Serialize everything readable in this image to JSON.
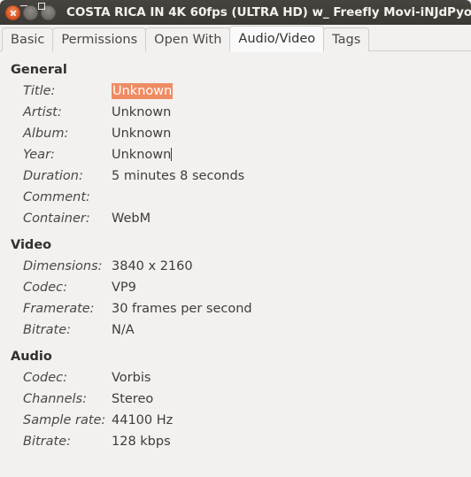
{
  "window": {
    "title": "COSTA RICA IN 4K 60fps (ULTRA HD) w_ Freefly Movi-iNJdPyo",
    "controls": {
      "close": "close-button",
      "minimize": "minimize-button",
      "maximize": "maximize-button"
    },
    "titlebar_color": "#413e3a",
    "background_color": "#f2f1f0",
    "selection_color": "#ef8b63"
  },
  "tabs": [
    {
      "label": "Basic",
      "active": false
    },
    {
      "label": "Permissions",
      "active": false
    },
    {
      "label": "Open With",
      "active": false
    },
    {
      "label": "Audio/Video",
      "active": true
    },
    {
      "label": "Tags",
      "active": false
    }
  ],
  "sections": [
    {
      "title": "General",
      "rows": [
        {
          "label": "Title:",
          "value": "Unknown",
          "state": "selected"
        },
        {
          "label": "Artist:",
          "value": "Unknown",
          "state": "normal"
        },
        {
          "label": "Album:",
          "value": "Unknown",
          "state": "normal"
        },
        {
          "label": "Year:",
          "value": "Unknown",
          "state": "caret"
        },
        {
          "label": "Duration:",
          "value": "5 minutes 8 seconds",
          "state": "normal"
        },
        {
          "label": "Comment:",
          "value": "",
          "state": "normal"
        },
        {
          "label": "Container:",
          "value": "WebM",
          "state": "normal"
        }
      ]
    },
    {
      "title": "Video",
      "rows": [
        {
          "label": "Dimensions:",
          "value": "3840 x 2160",
          "state": "normal"
        },
        {
          "label": "Codec:",
          "value": "VP9",
          "state": "normal"
        },
        {
          "label": "Framerate:",
          "value": "30 frames per second",
          "state": "normal"
        },
        {
          "label": "Bitrate:",
          "value": "N/A",
          "state": "normal"
        }
      ]
    },
    {
      "title": "Audio",
      "rows": [
        {
          "label": "Codec:",
          "value": "Vorbis",
          "state": "normal"
        },
        {
          "label": "Channels:",
          "value": "Stereo",
          "state": "normal"
        },
        {
          "label": "Sample rate:",
          "value": "44100 Hz",
          "state": "normal"
        },
        {
          "label": "Bitrate:",
          "value": "128 kbps",
          "state": "normal"
        }
      ]
    }
  ]
}
